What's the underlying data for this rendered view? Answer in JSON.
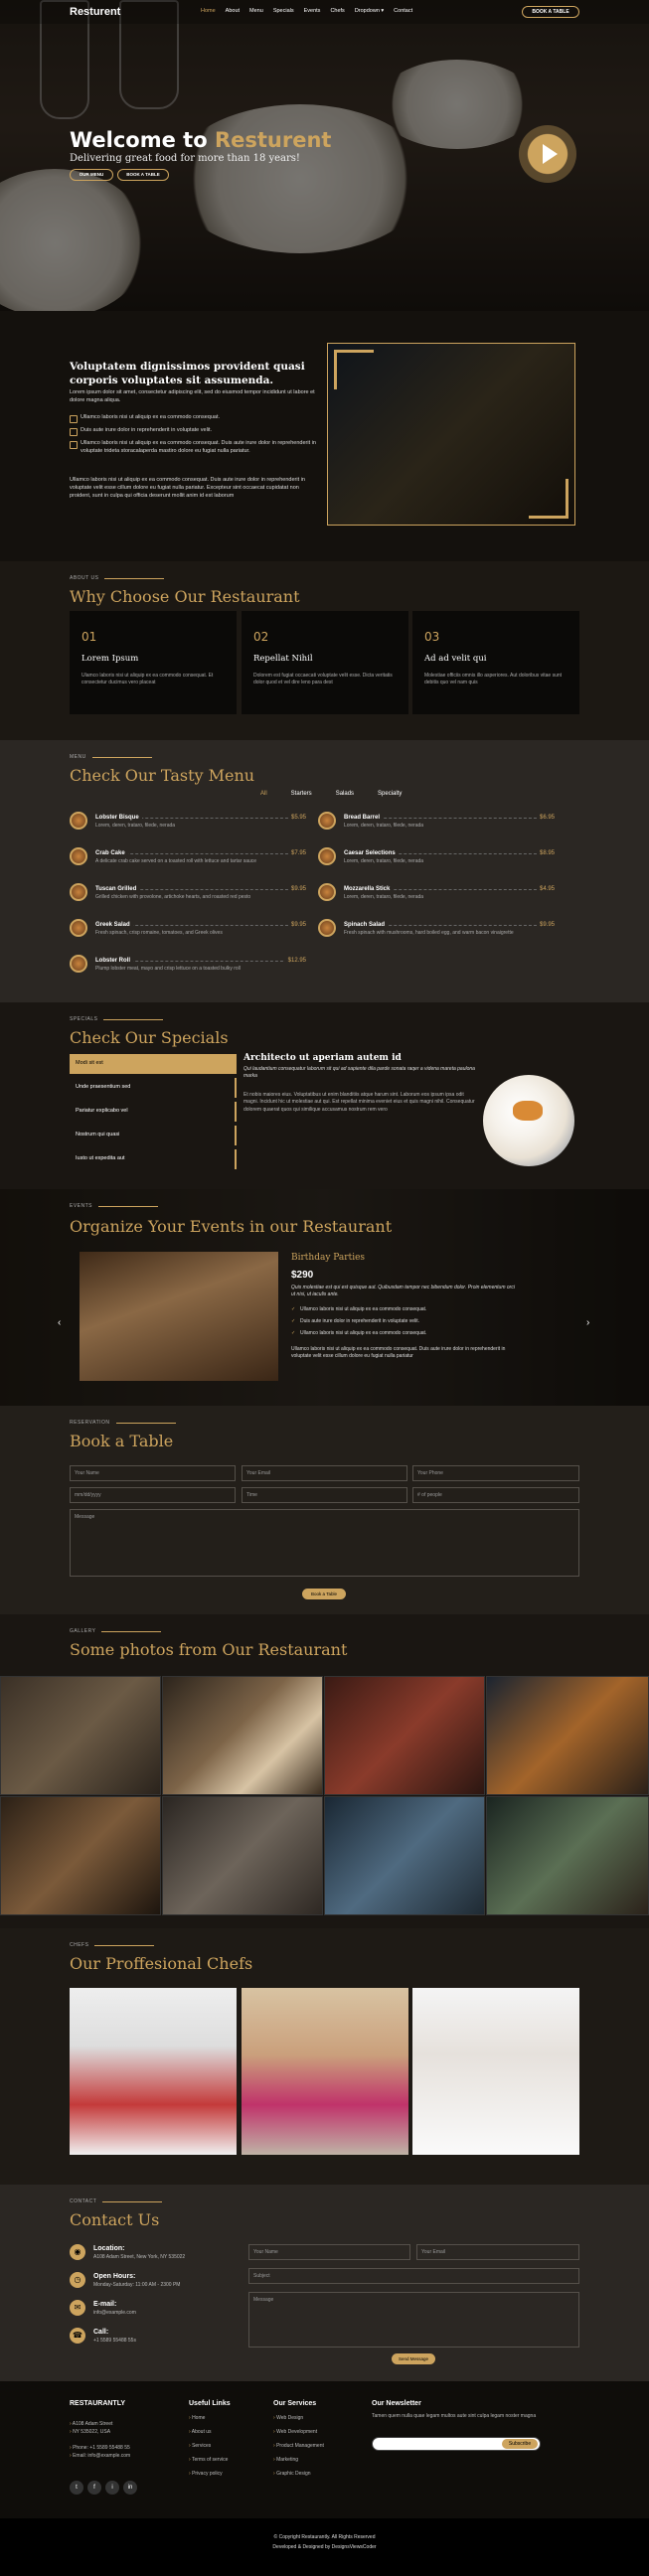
{
  "header": {
    "logo": "Resturent",
    "nav": [
      "Home",
      "About",
      "Menu",
      "Specials",
      "Events",
      "Chefs",
      "Dropdown ▾",
      "Contact"
    ],
    "book_button": "BOOK A TABLE"
  },
  "hero": {
    "title_plain": "Welcome to",
    "title_accent": "Resturent",
    "subtitle": "Delivering great food for more than 18 years!",
    "btn_menu": "OUR MENU",
    "btn_book": "BOOK A TABLE"
  },
  "about": {
    "title": "Voluptatem dignissimos provident quasi corporis voluptates sit assumenda.",
    "intro": "Lorem ipsum dolor sit amet, consectetur adipiscing elit, sed do eiusmod tempor incididunt ut labore et dolore magna aliqua.",
    "items": [
      "Ullamco laboris nisi ut aliquip ex ea commodo consequat.",
      "Duis aute irure dolor in reprehenderit in voluptate velit.",
      "Ullamco laboris nisi ut aliquip ex ea commodo consequat. Duis aute irure dolor in reprehenderit in voluptate trideta storacalaperda mastiro dolore eu fugiat nulla pariatur."
    ],
    "outro": "Ullamco laboris nisi ut aliquip ex ea commodo consequat. Duis aute irure dolor in reprehenderit in voluptate velit esse cillum dolore eu fugiat nulla pariatur. Excepteur sint occaecat cupidatat non proident, sunt in culpa qui officia deserunt mollit anim id est laborum"
  },
  "why": {
    "eyebrow": "ABOUT US",
    "title": "Why Choose Our Restaurant",
    "boxes": [
      {
        "num": "01",
        "title": "Lorem Ipsum",
        "desc": "Ulamco laboris nisi ut aliquip ex ea commodo consequat. Et consectetur ducimus vero placeat"
      },
      {
        "num": "02",
        "title": "Repellat Nihil",
        "desc": "Dolorem est fugiat occaecati voluptate velit esse. Dicta veritatis dolor quod et vel dire leno para dest"
      },
      {
        "num": "03",
        "title": "Ad ad velit qui",
        "desc": "Molestiae officiis omnis illo asperiores. Aut doloribus vitae sunt debitis quo vel nam quis"
      }
    ]
  },
  "menu": {
    "eyebrow": "MENU",
    "title": "Check Our Tasty Menu",
    "filters": [
      "All",
      "Starters",
      "Salads",
      "Specialty"
    ],
    "items": [
      {
        "name": "Lobster Bisque",
        "price": "$5.95",
        "desc": "Lorem, deren, trataro, filede, nerada"
      },
      {
        "name": "Bread Barrel",
        "price": "$6.95",
        "desc": "Lorem, deren, trataro, filede, nerada"
      },
      {
        "name": "Crab Cake",
        "price": "$7.95",
        "desc": "A delicate crab cake served on a toasted roll with lettuce and tartar sauce"
      },
      {
        "name": "Caesar Selections",
        "price": "$8.95",
        "desc": "Lorem, deren, trataro, filede, nerada"
      },
      {
        "name": "Tuscan Grilled",
        "price": "$9.95",
        "desc": "Grilled chicken with provolone, artichoke hearts, and roasted red pesto"
      },
      {
        "name": "Mozzarella Stick",
        "price": "$4.95",
        "desc": "Lorem, deren, trataro, filede, nerada"
      },
      {
        "name": "Greek Salad",
        "price": "$9.95",
        "desc": "Fresh spinach, crisp romaine, tomatoes, and Greek olives"
      },
      {
        "name": "Spinach Salad",
        "price": "$9.95",
        "desc": "Fresh spinach with mushrooms, hard boiled egg, and warm bacon vinaigrette"
      },
      {
        "name": "Lobster Roll",
        "price": "$12.95",
        "desc": "Plump lobster meat, mayo and crisp lettuce on a toasted bulky roll"
      }
    ]
  },
  "specials": {
    "eyebrow": "SPECIALS",
    "title": "Check Our Specials",
    "tabs": [
      "Modi sit est",
      "Unde praesentium sed",
      "Pariatur explicabo vel",
      "Nostrum qui quasi",
      "Iusto ut expedita aut"
    ],
    "content_title": "Architecto ut aperiam autem id",
    "content_lead": "Qui laudantium consequatur laborum sit qui ad sapiente dila parde sonata raqer a videna mareta paulona marka",
    "content_body": "Et nobis maiores eius. Voluptatibus ut enim blanditiis atque harum sint. Laborum eos ipsum ipsa odit magni. Incidunt hic ut molestiae aut qui. Est repellat minima eveniet eius et quis magni nihil. Consequatur dolorem quaerat quos qui similique accusamus nostrum rem vero"
  },
  "events": {
    "eyebrow": "EVENTS",
    "title": "Organize Your Events in our Restaurant",
    "name": "Birthday Parties",
    "price": "$290",
    "lead": "Quis molestiae est qui est quisque aut. Quibusdam tempor nec bibendum dolor. Proin elementum orci ut nisi, ut iaculis ante.",
    "items": [
      "Ullamco laboris nisi ut aliquip ex ea commodo consequat.",
      "Duis aute irure dolor in reprehenderit in voluptate velit.",
      "Ullamco laboris nisi ut aliquip ex ea commodo consequat."
    ],
    "outro": "Ullamco laboris nisi ut aliquip ex ea commodo consequat. Duis aute irure dolor in reprehenderit in voluptate velit esse cillum dolore eu fugiat nulla pariatur"
  },
  "book": {
    "eyebrow": "RESERVATION",
    "title": "Book a Table",
    "fields": [
      "Your Name",
      "Your Email",
      "Your Phone",
      "mm/dd/yyyy",
      "Time",
      "# of people"
    ],
    "message": "Message",
    "button": "Book a Table"
  },
  "gallery": {
    "eyebrow": "GALLERY",
    "title": "Some photos from Our Restaurant"
  },
  "chefs": {
    "eyebrow": "CHEFS",
    "title": "Our Proffesional Chefs"
  },
  "contact": {
    "eyebrow": "CONTACT",
    "title": "Contact Us",
    "items": [
      {
        "head": "Location:",
        "value": "A108 Adam Street, New York, NY 535022"
      },
      {
        "head": "Open Hours:",
        "value": "Monday-Saturday: 11:00 AM - 2300 PM"
      },
      {
        "head": "E-mail:",
        "value": "info@example.com"
      },
      {
        "head": "Call:",
        "value": "+1 5589 55488 55s"
      }
    ],
    "placeholders": [
      "Your Name",
      "Your Email",
      "Subject",
      "Message"
    ],
    "button": "Send Message"
  },
  "footer": {
    "brand": "RESTAURANTLY",
    "address1": "A108 Adam Street",
    "address2": "NY 535022, USA",
    "phone": "Phone: +1 5589 55488 55",
    "email": "Email: info@example.com",
    "useful_title": "Useful Links",
    "useful": [
      "Home",
      "About us",
      "Services",
      "Terms of service",
      "Privacy policy"
    ],
    "services_title": "Our Services",
    "services": [
      "Web Design",
      "Web Development",
      "Product Management",
      "Marketing",
      "Graphic Design"
    ],
    "news_title": "Our Newsletter",
    "news_text": "Tamen quem nulla quae legam multos aute sint culpa legam noster magna",
    "news_button": "Subscribe",
    "social": [
      "t",
      "f",
      "i",
      "in"
    ]
  },
  "copyright": {
    "line1": "© Copyright Restaurantly. All Rights Reserved",
    "line2": "Developed & Designed by DesignsViewsCoder"
  }
}
